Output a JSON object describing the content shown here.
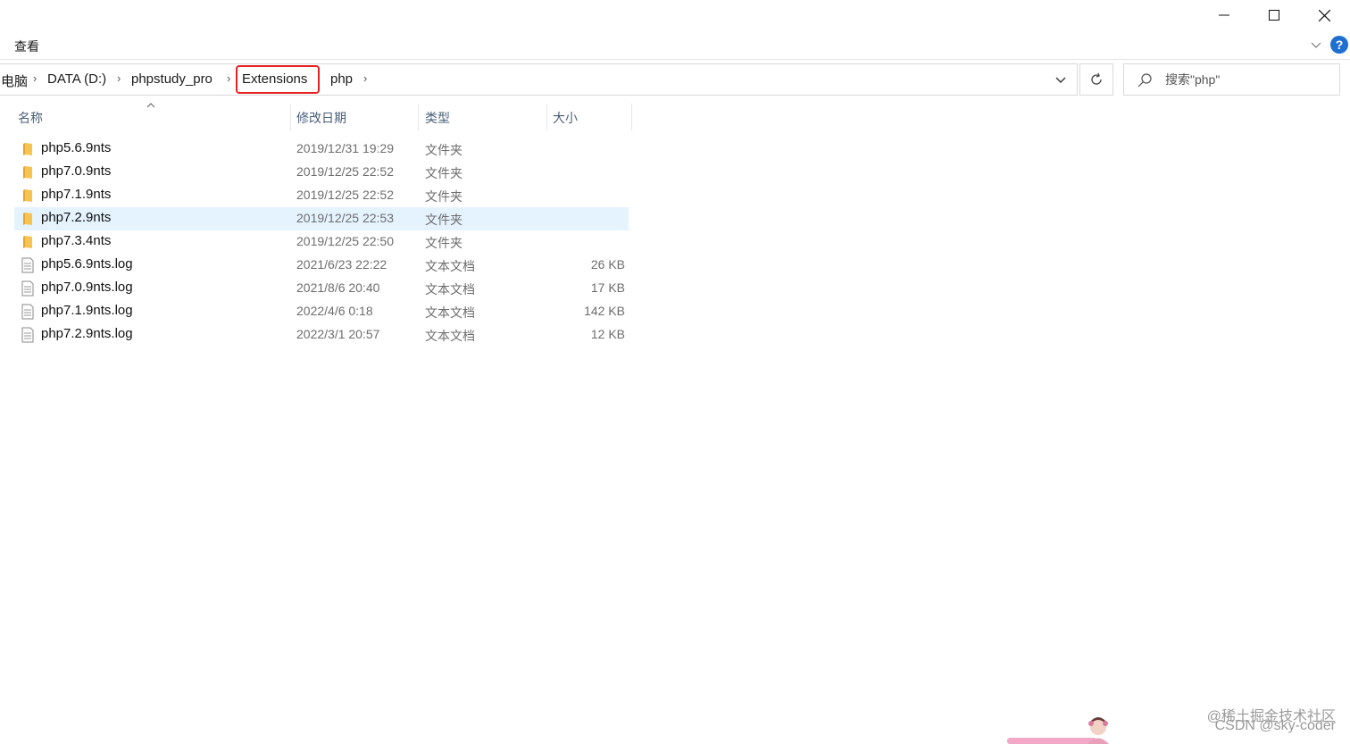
{
  "window": {
    "minimize_label": "Minimize",
    "maximize_label": "Maximize",
    "close_label": "Close"
  },
  "ribbon": {
    "view_tab": "查看",
    "help_label": "?"
  },
  "breadcrumb": {
    "items": [
      "电脑",
      "DATA (D:)",
      "phpstudy_pro",
      "Extensions",
      "php"
    ],
    "highlighted": "Extensions"
  },
  "search": {
    "placeholder": "搜索\"php\""
  },
  "columns": {
    "name": "名称",
    "date": "修改日期",
    "type": "类型",
    "size": "大小"
  },
  "files": [
    {
      "name": "php5.6.9nts",
      "date": "2019/12/31 19:29",
      "type": "文件夹",
      "size": "",
      "kind": "folder"
    },
    {
      "name": "php7.0.9nts",
      "date": "2019/12/25 22:52",
      "type": "文件夹",
      "size": "",
      "kind": "folder"
    },
    {
      "name": "php7.1.9nts",
      "date": "2019/12/25 22:52",
      "type": "文件夹",
      "size": "",
      "kind": "folder"
    },
    {
      "name": "php7.2.9nts",
      "date": "2019/12/25 22:53",
      "type": "文件夹",
      "size": "",
      "kind": "folder",
      "selected": true
    },
    {
      "name": "php7.3.4nts",
      "date": "2019/12/25 22:50",
      "type": "文件夹",
      "size": "",
      "kind": "folder"
    },
    {
      "name": "php5.6.9nts.log",
      "date": "2021/6/23 22:22",
      "type": "文本文档",
      "size": "26 KB",
      "kind": "text"
    },
    {
      "name": "php7.0.9nts.log",
      "date": "2021/8/6 20:40",
      "type": "文本文档",
      "size": "17 KB",
      "kind": "text"
    },
    {
      "name": "php7.1.9nts.log",
      "date": "2022/4/6 0:18",
      "type": "文本文档",
      "size": "142 KB",
      "kind": "text"
    },
    {
      "name": "php7.2.9nts.log",
      "date": "2022/3/1 20:57",
      "type": "文本文档",
      "size": "12 KB",
      "kind": "text"
    }
  ],
  "watermark": {
    "line1": "@稀土掘金技术社区",
    "line2": "CSDN @sky-coder"
  },
  "colors": {
    "selection": "#e5f3ff",
    "highlight_border": "#e52222",
    "folder": "#f6c453",
    "help": "#1f6fd0"
  }
}
